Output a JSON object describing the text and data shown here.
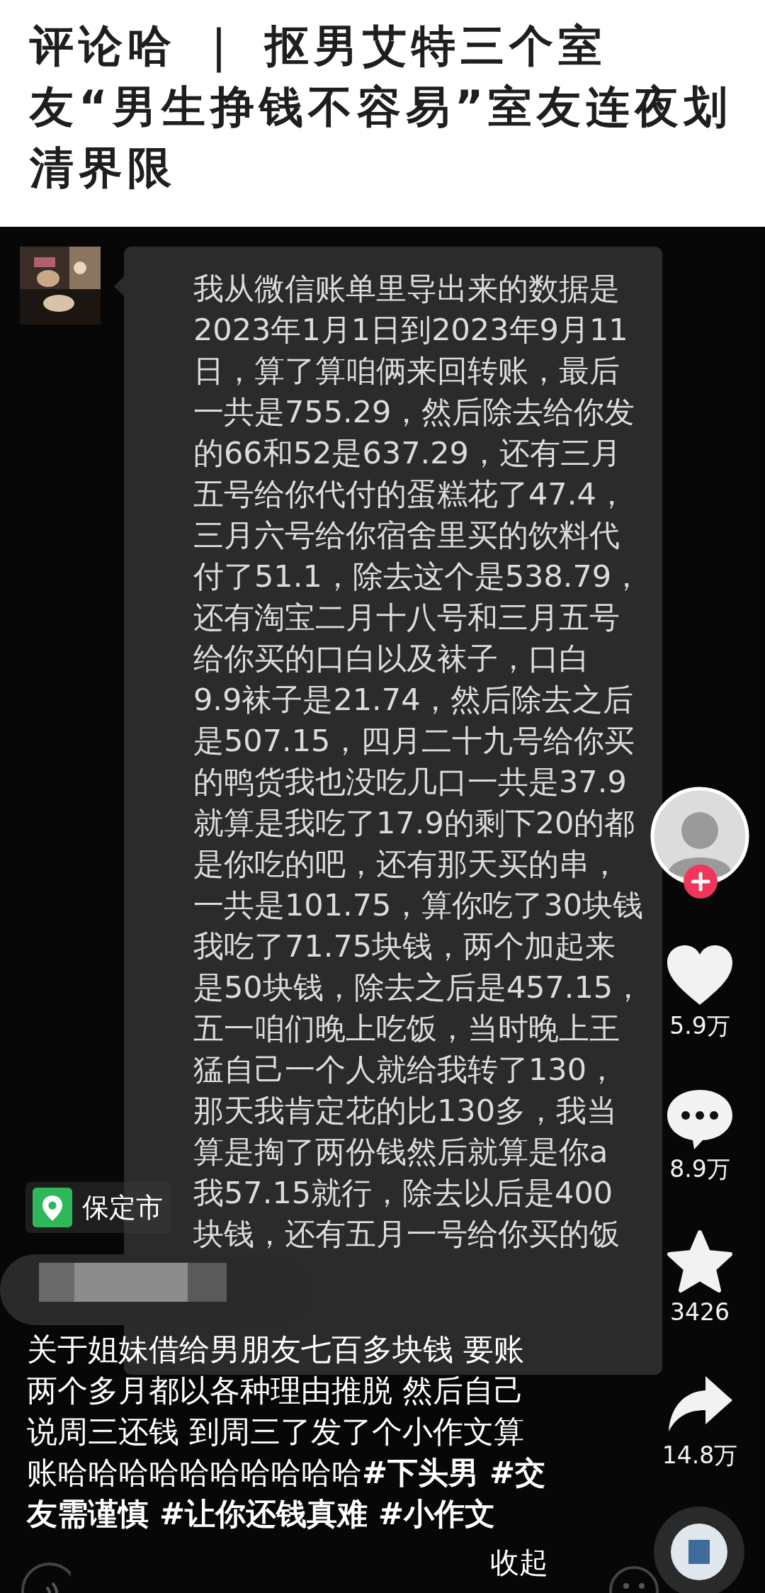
{
  "header": {
    "title": "评论哈 ｜ 抠男艾特三个室友“男生挣钱不容易”室友连夜划清界限"
  },
  "chat": {
    "message_lines": [
      "我从微信账单里导出来的数据是",
      "2023年1月1日到2023年9月11",
      "日，算了算咱俩来回转账，最后",
      "一共是755.29，然后除去给你发",
      "的66和52是637.29，还有三月",
      "五号给你代付的蛋糕花了47.4，",
      "三月六号给你宿舍里买的饮料代",
      "付了51.1，除去这个是538.79，",
      "还有淘宝二月十八号和三月五号",
      "给你买的口白以及袜子，口白",
      "9.9袜子是21.74，然后除去之后",
      "是507.15，四月二十九号给你买",
      "的鸭货我也没吃几口一共是37.9",
      "就算是我吃了17.9的剩下20的都",
      "是你吃的吧，还有那天买的串，",
      "一共是101.75，算你吃了30块钱",
      "我吃了71.75块钱，两个加起来",
      "是50块钱，除去之后是457.15，",
      "五一咱们晚上吃饭，当时晚上王",
      "猛自己一个人就给我转了130，",
      "那天我肯定花的比130多，我当",
      "算是掏了两份钱然后就算是你a",
      "我57.15就行，除去以后是400",
      "块钱，还有五月一号给你买的饭"
    ]
  },
  "location": {
    "label": "保定市"
  },
  "caption": {
    "text": "关于姐妹借给男朋友七百多块钱 要账两个多月都以各种理由推脱 然后自己说周三还钱 到周三了发了个小作文算账哈哈哈哈哈哈哈哈哈哈**#下头男 #交友需谨慎 #让你还钱真难 #小作文**",
    "collapse_label": "收起"
  },
  "actions": [
    {
      "kind": "like",
      "count": "5.9万"
    },
    {
      "kind": "comment",
      "count": "8.9万"
    },
    {
      "kind": "favorite",
      "count": "3426"
    },
    {
      "kind": "share",
      "count": "14.8万"
    }
  ]
}
